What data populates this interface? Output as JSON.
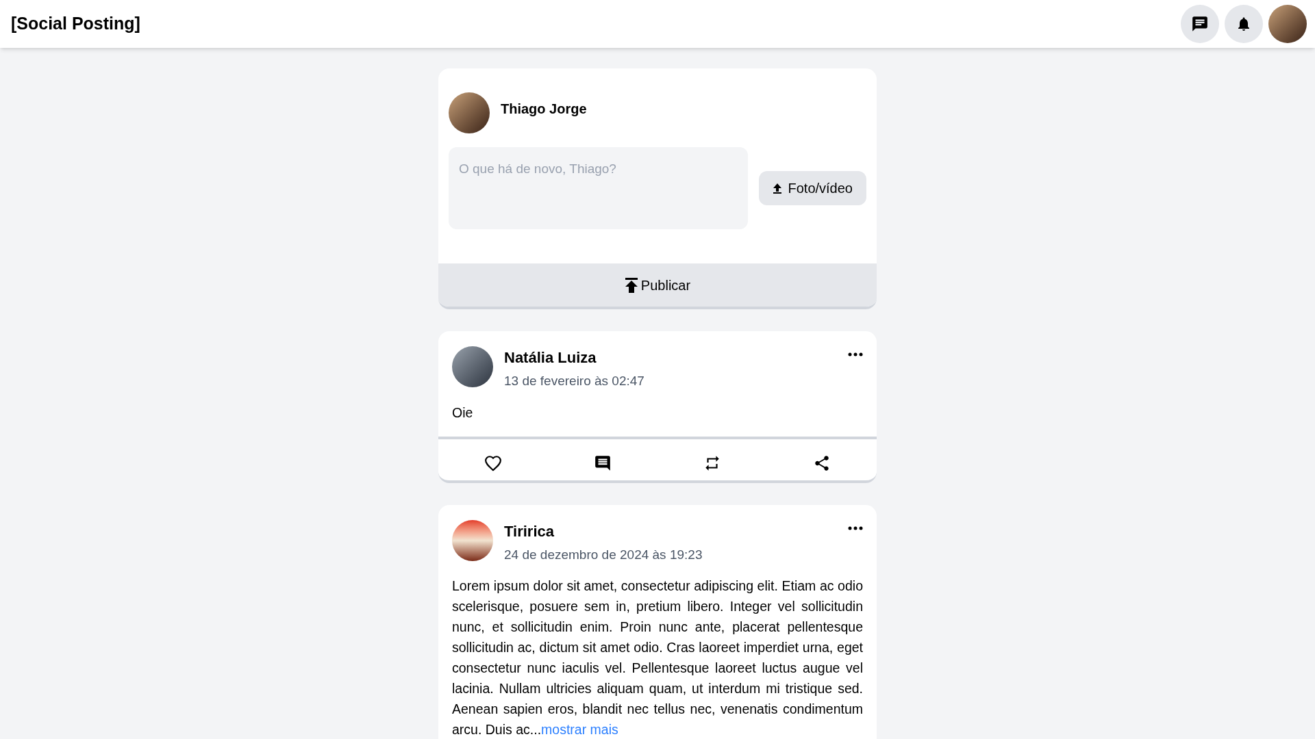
{
  "app_title": "[Social Posting]",
  "composer": {
    "author": "Thiago Jorge",
    "placeholder": "O que há de novo, Thiago?",
    "media_button": "Foto/vídeo",
    "publish_button": "Publicar"
  },
  "posts": [
    {
      "author": "Natália Luiza",
      "date": "13 de fevereiro às 02:47",
      "body": "Oie",
      "cut_off": false
    },
    {
      "author": "Tiririca",
      "date": "24 de dezembro de 2024 às 19:23",
      "body": "Lorem ipsum dolor sit amet, consectetur adipiscing elit. Etiam ac odio scelerisque, posuere sem in, pretium libero. Integer vel sollicitudin nunc, et sollicitudin enim. Proin nunc ante, placerat pellentesque sollicitudin ac, dictum sit amet odio. Cras laoreet imperdiet urna, eget consectetur nunc iaculis vel. Pellentesque laoreet luctus augue vel lacinia. Nullam ultricies aliquam quam, ut interdum mi tristique sed. Aenean sapien eros, blandit nec tellus nec, venenatis condimentum arcu. Duis ac...",
      "more_link": "mostrar mais",
      "cut_off": true
    }
  ]
}
